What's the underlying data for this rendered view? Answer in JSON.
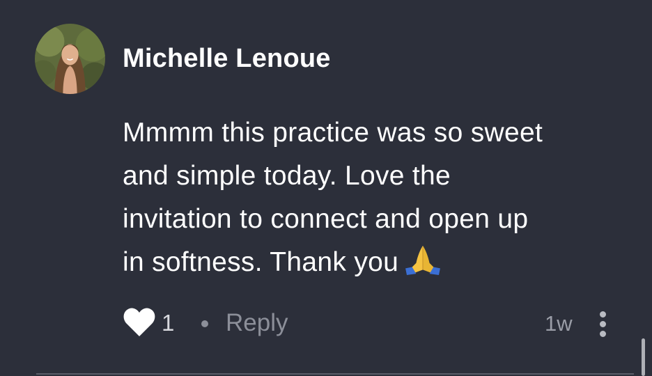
{
  "comment": {
    "author": "Michelle Lenoue",
    "body_lines": [
      "Mmmm this practice was so sweet",
      "and simple today. Love the",
      "invitation to connect and open up",
      "in softness. Thank you"
    ],
    "emoji": "folded-hands-emoji",
    "like_count": "1",
    "separator": "•",
    "reply_label": "Reply",
    "timestamp": "1w",
    "liked": true
  },
  "icons": {
    "like": "heart-icon",
    "more": "more-vertical-icon"
  },
  "colors": {
    "background": "#2c2f3a",
    "text_primary": "#ffffff",
    "text_muted": "#8c8f99",
    "heart": "#ffffff"
  }
}
